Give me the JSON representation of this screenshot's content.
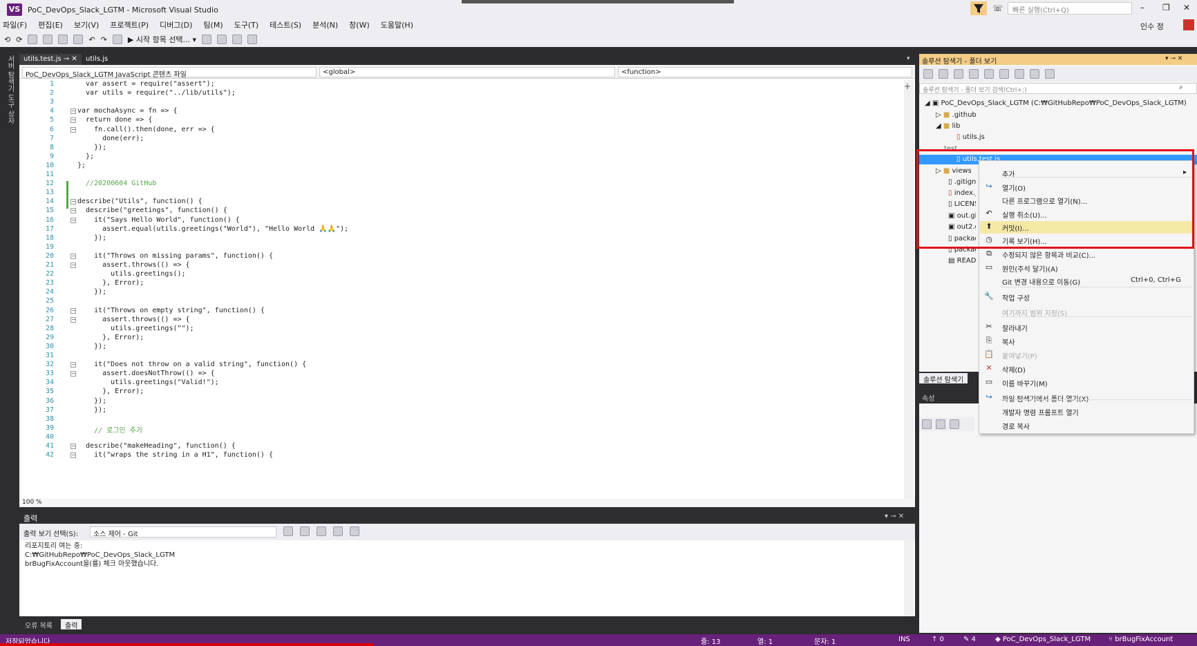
{
  "window": {
    "title": "PoC_DevOps_Slack_LGTM - Microsoft Visual Studio",
    "logo": "VS"
  },
  "menu": [
    "파일(F)",
    "편집(E)",
    "보기(V)",
    "프로젝트(P)",
    "디버그(D)",
    "팀(M)",
    "도구(T)",
    "테스트(S)",
    "분석(N)",
    "창(W)",
    "도움말(H)"
  ],
  "toolbar": {
    "start_label": "시작 항목 선택..."
  },
  "quick_launch": "빠른 실행(Ctrl+Q)",
  "user": "인수 정",
  "left_rail": "서버 탐색기  도구 상자",
  "tabs": {
    "active": "utils.test.js",
    "second": "utils.js"
  },
  "nav": {
    "project": "PoC_DevOps_Slack_LGTM JavaScript 콘텐츠 파일",
    "scope": "<global>",
    "member": "<function>"
  },
  "code_lines": [
    {
      "n": "1",
      "t": "  var assert = require(\"assert\");"
    },
    {
      "n": "2",
      "t": "  var utils = require(\"../lib/utils\");"
    },
    {
      "n": "3",
      "t": ""
    },
    {
      "n": "4",
      "t": "var mochaAsync = fn => {"
    },
    {
      "n": "5",
      "t": "  return done => {"
    },
    {
      "n": "6",
      "t": "    fn.call().then(done, err => {"
    },
    {
      "n": "7",
      "t": "      done(err);"
    },
    {
      "n": "8",
      "t": "    });"
    },
    {
      "n": "9",
      "t": "  };"
    },
    {
      "n": "10",
      "t": "};"
    },
    {
      "n": "11",
      "t": ""
    },
    {
      "n": "12",
      "t": "  //20200604 GitHub"
    },
    {
      "n": "13",
      "t": ""
    },
    {
      "n": "14",
      "t": "describe(\"Utils\", function() {"
    },
    {
      "n": "15",
      "t": "  describe(\"greetings\", function() {"
    },
    {
      "n": "16",
      "t": "    it(\"Says Hello World\", function() {"
    },
    {
      "n": "17",
      "t": "      assert.equal(utils.greetings(\"World\"), \"Hello World 🙏🙏\");"
    },
    {
      "n": "18",
      "t": "    });"
    },
    {
      "n": "19",
      "t": ""
    },
    {
      "n": "20",
      "t": "    it(\"Throws on missing params\", function() {"
    },
    {
      "n": "21",
      "t": "      assert.throws(() => {"
    },
    {
      "n": "22",
      "t": "        utils.greetings();"
    },
    {
      "n": "23",
      "t": "      }, Error);"
    },
    {
      "n": "24",
      "t": "    });"
    },
    {
      "n": "25",
      "t": ""
    },
    {
      "n": "26",
      "t": "    it(\"Throws on empty string\", function() {"
    },
    {
      "n": "27",
      "t": "      assert.throws(() => {"
    },
    {
      "n": "28",
      "t": "        utils.greetings(\"\");"
    },
    {
      "n": "29",
      "t": "      }, Error);"
    },
    {
      "n": "30",
      "t": "    });"
    },
    {
      "n": "31",
      "t": ""
    },
    {
      "n": "32",
      "t": "    it(\"Does not throw on a valid string\", function() {"
    },
    {
      "n": "33",
      "t": "      assert.doesNotThrow(() => {"
    },
    {
      "n": "34",
      "t": "        utils.greetings(\"Valid!\");"
    },
    {
      "n": "35",
      "t": "      }, Error);"
    },
    {
      "n": "36",
      "t": "    });"
    },
    {
      "n": "37",
      "t": "    });"
    },
    {
      "n": "38",
      "t": ""
    },
    {
      "n": "39",
      "t": "    // 로그인 추가"
    },
    {
      "n": "40",
      "t": ""
    },
    {
      "n": "41",
      "t": "  describe(\"makeHeading\", function() {"
    },
    {
      "n": "42",
      "t": "    it(\"wraps the string in a H1\", function() {"
    }
  ],
  "zoom": "100 %",
  "output": {
    "header": "출력",
    "show_label": "출력 보기 선택(S):",
    "source": "소스 제어 - Git",
    "lines": [
      "리포지토리 여는 중:",
      "C:₩GitHubRepo₩PoC_DevOps_Slack_LGTM",
      "brBugFixAccount을(를) 체크 아웃했습니다."
    ]
  },
  "bottom_tabs": [
    "오류 목록",
    "출력"
  ],
  "status": {
    "left": "저장되었습니다",
    "ln": "줄: 13",
    "col": "열: 1",
    "ch": "문자: 1",
    "ins": "INS",
    "up": "↑ 0",
    "pencil": "✎ 4",
    "repo": "PoC_DevOps_Slack_LGTM",
    "branch": "brBugFixAccount"
  },
  "solution_explorer": {
    "title": "솔루션 탐색기 - 폴더 보기",
    "search": "솔루션 탐색기 - 폴더 보기 검색(Ctrl+;)",
    "root": "PoC_DevOps_Slack_LGTM (C:₩GitHubRepo₩PoC_DevOps_Slack_LGTM)",
    "nodes": [
      ".github",
      "lib",
      "utils.js",
      "test",
      "utils.test.js",
      "views",
      ".gitignore",
      "index.js",
      "LICENSE",
      "out.gif",
      "out2.gif",
      "package.json",
      "package-lock.json",
      "README.md"
    ],
    "bottom_tab": "솔루션 탐색기"
  },
  "properties": {
    "title": "속성"
  },
  "context_menu": [
    {
      "label": "추가",
      "icon": "",
      "submenu": true
    },
    {
      "label": "열기(O)",
      "icon": "open-icon"
    },
    {
      "label": "다른 프로그램으로 열기(N)...",
      "icon": ""
    },
    {
      "label": "실행 취소(U)...",
      "icon": "undo-icon"
    },
    {
      "label": "커밋(I)...",
      "icon": "commit-icon",
      "highlight": true
    },
    {
      "label": "기록 보기(H)...",
      "icon": "history-icon"
    },
    {
      "label": "수정되지 않은 항목과 비교(C)...",
      "icon": "compare-icon"
    },
    {
      "label": "원인(주석 달기)(A)",
      "icon": "annotate-icon"
    },
    {
      "label": "Git 변경 내용으로 이동(G)",
      "icon": "",
      "shortcut": "Ctrl+0, Ctrl+G"
    },
    {
      "label": "작업 구성",
      "icon": "wrench-icon"
    },
    {
      "label": "여기까지 범위 지정(S)",
      "icon": "",
      "disabled": true
    },
    {
      "label": "잘라내기",
      "icon": "cut-icon"
    },
    {
      "label": "복사",
      "icon": "copy-icon"
    },
    {
      "label": "붙여넣기(P)",
      "icon": "paste-icon",
      "disabled": true
    },
    {
      "label": "삭제(D)",
      "icon": "delete-icon"
    },
    {
      "label": "이름 바꾸기(M)",
      "icon": "rename-icon"
    },
    {
      "label": "파일 탐색기에서 폴더 열기(X)",
      "icon": "folder-open-icon"
    },
    {
      "label": "개발자 명령 프롬프트 열기",
      "icon": ""
    },
    {
      "label": "경로 복사",
      "icon": ""
    }
  ],
  "colors": {
    "accent": "#68217a",
    "highlight_box": "#e0101a",
    "selection": "#3399ff"
  }
}
